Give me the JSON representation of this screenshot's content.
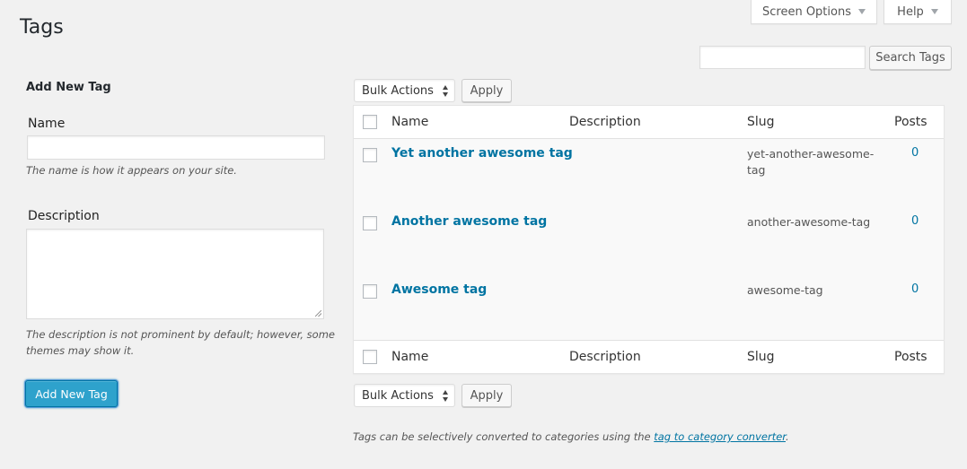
{
  "top_tabs": {
    "screen_options": "Screen Options",
    "help": "Help"
  },
  "page": {
    "title": "Tags"
  },
  "search": {
    "value": "",
    "button": "Search Tags"
  },
  "form": {
    "heading": "Add New Tag",
    "name_label": "Name",
    "name_value": "",
    "name_hint": "The name is how it appears on your site.",
    "description_label": "Description",
    "description_value": "",
    "description_hint_line1": "The description is not prominent by default; however, some",
    "description_hint_line2": "themes may show it.",
    "submit": "Add New Tag"
  },
  "bulk": {
    "selected": "Bulk Actions",
    "apply": "Apply"
  },
  "table": {
    "columns": [
      "Name",
      "Description",
      "Slug",
      "Posts"
    ],
    "rows": [
      {
        "name": "Yet another awesome tag",
        "description": "",
        "slug_line1": "yet-another-awesome-",
        "slug_line2": "tag",
        "count": "0"
      },
      {
        "name": "Another awesome tag",
        "description": "",
        "slug_line1": "another-awesome-tag",
        "slug_line2": "",
        "count": "0"
      },
      {
        "name": "Awesome tag",
        "description": "",
        "slug_line1": "awesome-tag",
        "slug_line2": "",
        "count": "0"
      }
    ]
  },
  "footer": {
    "note_prefix": "Tags can be selectively converted to categories using the ",
    "link": "tag to category converter",
    "note_suffix": "."
  },
  "colors": {
    "link": "#0074a2",
    "primary_button": "#2ea2cc",
    "background": "#f1f1f1"
  },
  "icons": {
    "screen_options_caret": "chevron-down-icon",
    "help_caret": "chevron-down-icon",
    "select_arrows": "up-down-arrows-icon"
  }
}
